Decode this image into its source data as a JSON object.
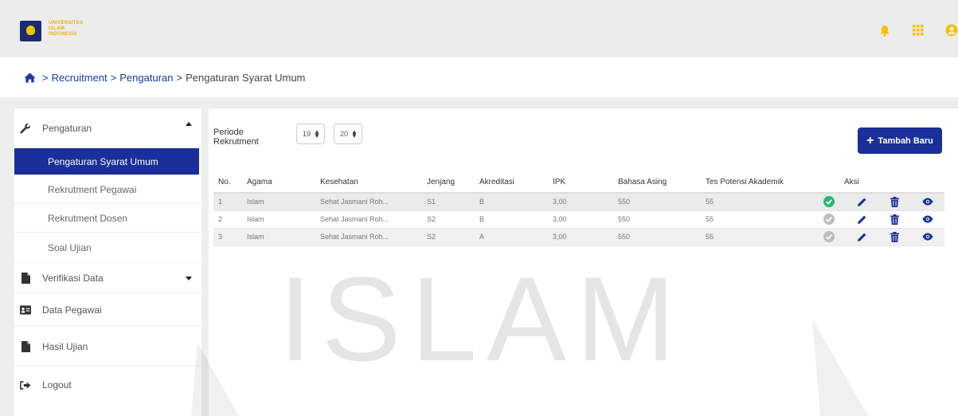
{
  "header": {
    "logo_lines": [
      "UNIVERSITAS",
      "ISLAM",
      "INDONESIA"
    ],
    "icons": [
      "bell-icon",
      "grid-icon",
      "user-icon"
    ],
    "accent_color": "#f2c200"
  },
  "breadcrumb": {
    "home_icon": "home-icon",
    "items": [
      "Recruitment",
      "Pengaturan"
    ],
    "current": "Pengaturan Syarat Umum",
    "separator": ">"
  },
  "sidebar": {
    "pengaturan_label": "Pengaturan",
    "sub_items": [
      "Pengaturan Syarat Umum",
      "Rekrutment Pegawai",
      "Rekrutment Dosen",
      "Soal Ujian"
    ],
    "verifikasi_label": "Verifikasi Data",
    "data_pegawai_label": "Data Pegawai",
    "hasil_ujian_label": "Hasil Ujian",
    "logout_label": "Logout",
    "active_color": "#1a2f9a"
  },
  "main": {
    "period_label_line1": "Periode",
    "period_label_line2": "Rekrutment",
    "period_from": "19",
    "period_to": "20",
    "add_button_label": "Tambah Baru",
    "columns": [
      "No.",
      "Agama",
      "Kesehatan",
      "Jenjang",
      "Akreditasi",
      "IPK",
      "Bahasa Asing",
      "Tes Potensi Akademik",
      "Aksi"
    ],
    "rows": [
      {
        "no": "1",
        "agama": "Islam",
        "kesehatan": "Sehat Jasmani Roh...",
        "jenjang": "S1",
        "akreditasi": "B",
        "ipk": "3,00",
        "bahasa": "550",
        "tpa": "55",
        "active": true
      },
      {
        "no": "2",
        "agama": "Islam",
        "kesehatan": "Sehat Jasmani Roh...",
        "jenjang": "S2",
        "akreditasi": "B",
        "ipk": "3,00",
        "bahasa": "550",
        "tpa": "55",
        "active": false
      },
      {
        "no": "3",
        "agama": "Islam",
        "kesehatan": "Sehat Jasmani Roh...",
        "jenjang": "S2",
        "akreditasi": "A",
        "ipk": "3,00",
        "bahasa": "550",
        "tpa": "55",
        "active": false
      }
    ]
  },
  "watermark": {
    "text": "ISLAM"
  }
}
